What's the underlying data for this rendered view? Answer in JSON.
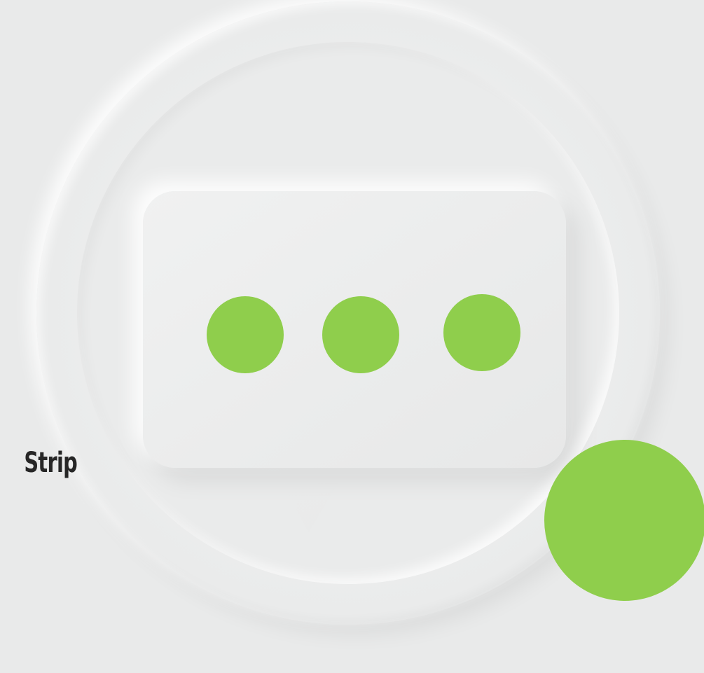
{
  "slide": {
    "label_text": "Strip",
    "background_color": "#e9eaea",
    "accent_color": "#8fce4c",
    "text_color": "#262626"
  },
  "chat_bubble": {
    "icon": "chat-bubble-icon",
    "dots": [
      {
        "icon": "typing-dot-icon"
      },
      {
        "icon": "typing-dot-icon"
      },
      {
        "icon": "typing-dot-icon"
      }
    ]
  },
  "accent": {
    "icon": "green-circle-accent"
  }
}
